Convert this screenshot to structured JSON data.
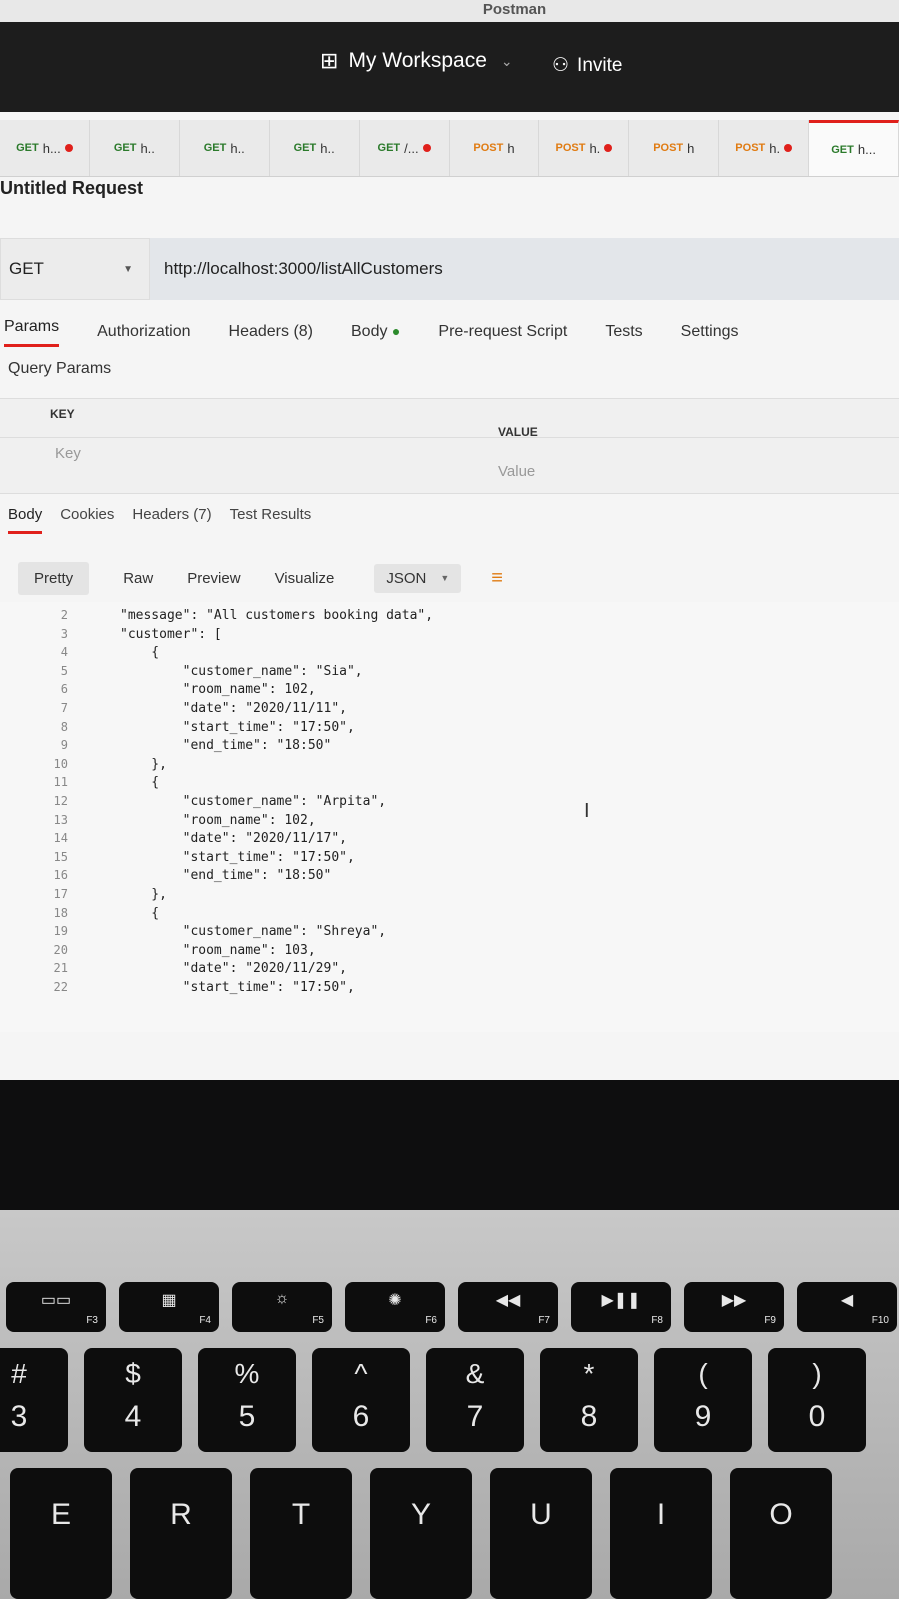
{
  "app": {
    "title": "Postman"
  },
  "topbar": {
    "workspace": "My Workspace",
    "invite": "Invite"
  },
  "tabs": [
    {
      "method": "GET",
      "label": "h...",
      "dot": true
    },
    {
      "method": "GET",
      "label": "h..",
      "dot": false
    },
    {
      "method": "GET",
      "label": "h..",
      "dot": false
    },
    {
      "method": "GET",
      "label": "h..",
      "dot": false
    },
    {
      "method": "GET",
      "label": "/...",
      "dot": true
    },
    {
      "method": "POST",
      "label": "h",
      "dot": false
    },
    {
      "method": "POST",
      "label": "h.",
      "dot": true
    },
    {
      "method": "POST",
      "label": "h",
      "dot": false
    },
    {
      "method": "POST",
      "label": "h.",
      "dot": true
    },
    {
      "method": "GET",
      "label": "h...",
      "dot": false
    }
  ],
  "request": {
    "title": "Untitled Request",
    "method": "GET",
    "url": "http://localhost:3000/listAllCustomers"
  },
  "request_tabs": {
    "params": "Params",
    "authorization": "Authorization",
    "headers": "Headers (8)",
    "body": "Body",
    "pre_request": "Pre-request Script",
    "tests": "Tests",
    "settings": "Settings"
  },
  "query_params": {
    "title": "Query Params",
    "key_header": "KEY",
    "value_header": "VALUE",
    "key_placeholder": "Key",
    "value_placeholder": "Value"
  },
  "response_tabs": {
    "body": "Body",
    "cookies": "Cookies",
    "headers": "Headers (7)",
    "test_results": "Test Results"
  },
  "view": {
    "pretty": "Pretty",
    "raw": "Raw",
    "preview": "Preview",
    "visualize": "Visualize",
    "format": "JSON"
  },
  "code_lines": [
    {
      "n": "2",
      "text": "\"message\": \"All customers booking data\","
    },
    {
      "n": "3",
      "text": "\"customer\": ["
    },
    {
      "n": "4",
      "text": "    {"
    },
    {
      "n": "5",
      "text": "        \"customer_name\": \"Sia\","
    },
    {
      "n": "6",
      "text": "        \"room_name\": 102,"
    },
    {
      "n": "7",
      "text": "        \"date\": \"2020/11/11\","
    },
    {
      "n": "8",
      "text": "        \"start_time\": \"17:50\","
    },
    {
      "n": "9",
      "text": "        \"end_time\": \"18:50\""
    },
    {
      "n": "10",
      "text": "    },"
    },
    {
      "n": "11",
      "text": "    {"
    },
    {
      "n": "12",
      "text": "        \"customer_name\": \"Arpita\","
    },
    {
      "n": "13",
      "text": "        \"room_name\": 102,"
    },
    {
      "n": "14",
      "text": "        \"date\": \"2020/11/17\","
    },
    {
      "n": "15",
      "text": "        \"start_time\": \"17:50\","
    },
    {
      "n": "16",
      "text": "        \"end_time\": \"18:50\""
    },
    {
      "n": "17",
      "text": "    },"
    },
    {
      "n": "18",
      "text": "    {"
    },
    {
      "n": "19",
      "text": "        \"customer_name\": \"Shreya\","
    },
    {
      "n": "20",
      "text": "        \"room_name\": 103,"
    },
    {
      "n": "21",
      "text": "        \"date\": \"2020/11/29\","
    },
    {
      "n": "22",
      "text": "        \"start_time\": \"17:50\","
    }
  ],
  "function_keys": [
    {
      "label": "F3",
      "icon": "mission-control-icon"
    },
    {
      "label": "F4",
      "icon": "launchpad-icon"
    },
    {
      "label": "F5",
      "icon": "keyboard-backlight-down-icon"
    },
    {
      "label": "F6",
      "icon": "keyboard-backlight-up-icon"
    },
    {
      "label": "F7",
      "icon": "rewind-icon"
    },
    {
      "label": "F8",
      "icon": "play-pause-icon"
    },
    {
      "label": "F9",
      "icon": "fast-forward-icon"
    },
    {
      "label": "F10",
      "icon": "mute-icon"
    }
  ],
  "number_keys": [
    {
      "sym": "#",
      "num": "3"
    },
    {
      "sym": "$",
      "num": "4"
    },
    {
      "sym": "%",
      "num": "5"
    },
    {
      "sym": "^",
      "num": "6"
    },
    {
      "sym": "&",
      "num": "7"
    },
    {
      "sym": "*",
      "num": "8"
    },
    {
      "sym": "(",
      "num": "9"
    },
    {
      "sym": ")",
      "num": "0"
    }
  ],
  "letter_keys": [
    "E",
    "R",
    "T",
    "Y",
    "U",
    "I",
    "O"
  ]
}
